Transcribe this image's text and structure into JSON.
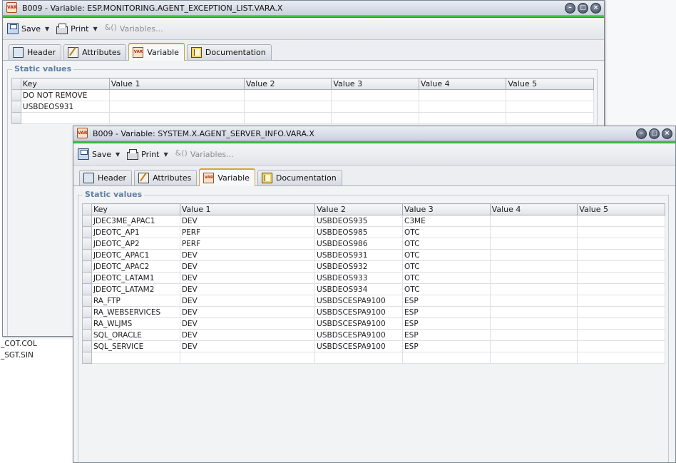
{
  "background": {
    "list_items": [
      "_COT.COL",
      "_SGT.SIN"
    ]
  },
  "window1": {
    "title": "B009 - Variable: ESP.MONITORING.AGENT_EXCEPTION_LIST.VARA.X",
    "title_icon": "VAR",
    "toolbar": {
      "save": "Save",
      "print": "Print",
      "variables": "Variables..."
    },
    "tabs": [
      "Header",
      "Attributes",
      "Variable",
      "Documentation"
    ],
    "active_tab": "Variable",
    "group_label": "Static values",
    "columns": [
      "Key",
      "Value 1",
      "Value 2",
      "Value 3",
      "Value 4",
      "Value 5"
    ],
    "rows": [
      [
        "DO NOT REMOVE",
        "",
        "",
        "",
        "",
        ""
      ],
      [
        "USBDEOS931",
        "",
        "",
        "",
        "",
        ""
      ],
      [
        "",
        "",
        "",
        "",
        "",
        ""
      ]
    ]
  },
  "window2": {
    "title": "B009 - Variable: SYSTEM.X.AGENT_SERVER_INFO.VARA.X",
    "title_icon": "VAR",
    "toolbar": {
      "save": "Save",
      "print": "Print",
      "variables": "Variables..."
    },
    "tabs": [
      "Header",
      "Attributes",
      "Variable",
      "Documentation"
    ],
    "active_tab": "Variable",
    "group_label": "Static values",
    "columns": [
      "Key",
      "Value 1",
      "Value 2",
      "Value 3",
      "Value 4",
      "Value 5"
    ],
    "rows": [
      [
        "JDEC3ME_APAC1",
        "DEV",
        "USBDEOS935",
        "C3ME",
        "",
        ""
      ],
      [
        "JDEOTC_AP1",
        "PERF",
        "USBDEOS985",
        "OTC",
        "",
        ""
      ],
      [
        "JDEOTC_AP2",
        "PERF",
        "USBDEOS986",
        "OTC",
        "",
        ""
      ],
      [
        "JDEOTC_APAC1",
        "DEV",
        "USBDEOS931",
        "OTC",
        "",
        ""
      ],
      [
        "JDEOTC_APAC2",
        "DEV",
        "USBDEOS932",
        "OTC",
        "",
        ""
      ],
      [
        "JDEOTC_LATAM1",
        "DEV",
        "USBDEOS933",
        "OTC",
        "",
        ""
      ],
      [
        "JDEOTC_LATAM2",
        "DEV",
        "USBDEOS934",
        "OTC",
        "",
        ""
      ],
      [
        "RA_FTP",
        "DEV",
        "USBDSCESPA9100",
        "ESP",
        "",
        ""
      ],
      [
        "RA_WEBSERVICES",
        "DEV",
        "USBDSCESPA9100",
        "ESP",
        "",
        ""
      ],
      [
        "RA_WLJMS",
        "DEV",
        "USBDSCESPA9100",
        "ESP",
        "",
        ""
      ],
      [
        "SQL_ORACLE",
        "DEV",
        "USBDSCESPA9100",
        "ESP",
        "",
        ""
      ],
      [
        "SQL_SERVICE",
        "DEV",
        "USBDSCESPA9100",
        "ESP",
        "",
        ""
      ],
      [
        "",
        "",
        "",
        "",
        "",
        ""
      ]
    ]
  },
  "colors": {
    "accent_green": "#3cc43c",
    "group_label": "#5e7fa6",
    "active_tab_border": "#d2a33a"
  }
}
